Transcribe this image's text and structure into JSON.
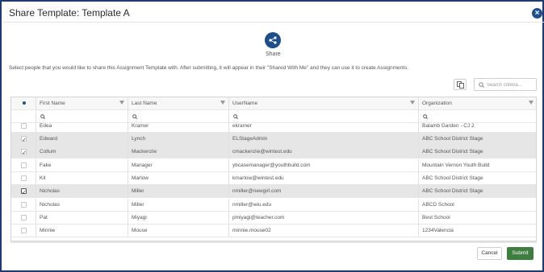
{
  "dialog": {
    "title": "Share Template: Template A",
    "close_icon": "close-icon"
  },
  "share": {
    "label": "Share",
    "icon": "share-icon"
  },
  "description": "Select people that you would like to share this Assignment Template with. After submitting, it will appear in their \"Shared With Me\" and they can use it to create Assignments.",
  "toolbar": {
    "export_icon": "export-icon",
    "search_placeholder": "Search criteria..."
  },
  "grid": {
    "columns": [
      "First Name",
      "Last Name",
      "UserName",
      "Organization"
    ],
    "partial_row": {
      "first": "Edea",
      "last": "Kramer",
      "username": "ekramer",
      "org": "Balamb Garden - CJ 2"
    },
    "rows": [
      {
        "first": "Edward",
        "last": "Lynch",
        "username": "ELStageAdmin",
        "org": "ABC School District Stage",
        "checked": true,
        "selected": true
      },
      {
        "first": "Collum",
        "last": "Mackenzie",
        "username": "cmackenzie@wintest.edu",
        "org": "ABC School District Stage",
        "checked": true,
        "selected": true
      },
      {
        "first": "Fake",
        "last": "Manager",
        "username": "ybcasemanager@youthbuild.com",
        "org": "Mountain Vernon Youth Build",
        "checked": false,
        "selected": false
      },
      {
        "first": "Kit",
        "last": "Marlow",
        "username": "kmarlow@wintest.edu",
        "org": "ABC School District Stage",
        "checked": false,
        "selected": false
      },
      {
        "first": "Nicholas",
        "last": "Miller",
        "username": "nmiller@newgirl.com",
        "org": "ABC School District Stage",
        "checked": true,
        "selected": true
      },
      {
        "first": "Nicholas",
        "last": "Miller",
        "username": "nmiller@wiu.edu",
        "org": "ABCD School",
        "checked": false,
        "selected": false
      },
      {
        "first": "Pat",
        "last": "Miyagi",
        "username": "pmiyagi@teacher.com",
        "org": "Best School",
        "checked": false,
        "selected": false
      },
      {
        "first": "Minnie",
        "last": "Mouse",
        "username": "minnie.mouse02",
        "org": "1234Valencia",
        "checked": false,
        "selected": false
      }
    ]
  },
  "footer": {
    "cancel_label": "Cancel",
    "submit_label": "Submit"
  },
  "colors": {
    "accent": "#1f4e8c",
    "submit": "#3e7e3e",
    "selected_row": "#e6e6e6",
    "frame_border": "#1f3a6e"
  }
}
